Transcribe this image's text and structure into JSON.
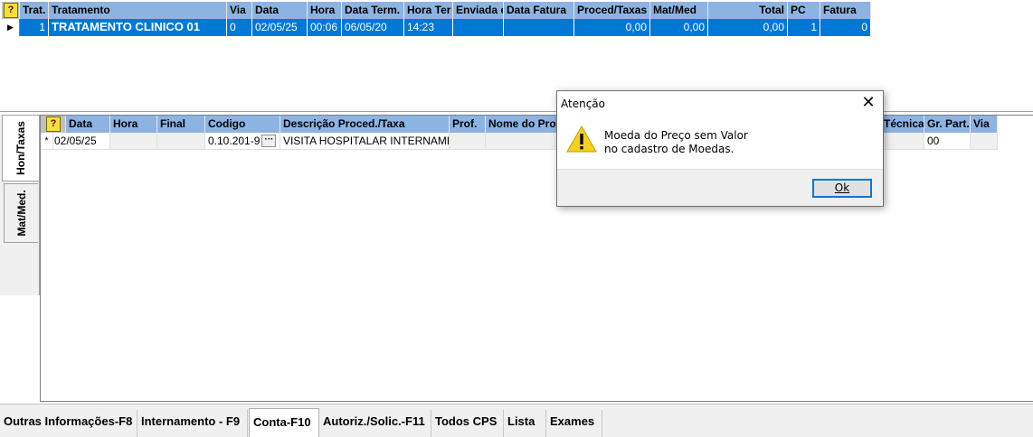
{
  "top_grid": {
    "help_icon": "?",
    "columns": [
      "Trat.",
      "Tratamento",
      "Via",
      "Data",
      "Hora",
      "Data Term.",
      "Hora Ter",
      "Enviada e",
      "Data Fatura",
      "Proced/Taxas",
      "Mat/Med",
      "Total",
      "PC",
      "Fatura"
    ],
    "row": {
      "indicator": "▶",
      "trat": "1",
      "tratamento": "TRATAMENTO CLINICO 01",
      "via": "0",
      "data": "02/05/25",
      "hora": "00:06",
      "data_term": "06/05/20",
      "hora_term": "14:23",
      "enviada": "",
      "data_fatura": "",
      "proced_taxas": "0,00",
      "mat_med": "0,00",
      "total": "0,00",
      "pc": "1",
      "fatura": "0"
    }
  },
  "side_tabs": [
    "Hon/Taxas",
    "Mat/Med."
  ],
  "bottom_grid": {
    "help_icon": "?",
    "columns": [
      "Data",
      "Hora",
      "Final",
      "Codigo",
      "Descrição Proced./Taxa",
      "Prof.",
      "Nome do Prof",
      "Técnica",
      "Gr. Part.",
      "Via"
    ],
    "row": {
      "indicator": "*",
      "data": "02/05/25",
      "hora": "",
      "final": "",
      "codigo": "0.10.201-9",
      "ellipsis": "···",
      "descricao": "VISITA HOSPITALAR INTERNAME",
      "prof": "",
      "nome_prof": "",
      "tecnica": "",
      "gr_part": "00",
      "via": ""
    }
  },
  "bottom_tabs": [
    "Outras Informações-F8",
    "Internamento - F9",
    "Conta-F10",
    "Autoriz./Solic.-F11",
    "Todos CPS",
    "Lista",
    "Exames"
  ],
  "active_bottom_tab": "Conta-F10",
  "dialog": {
    "title": "Atenção",
    "close_icon": "✕",
    "icon": "warning-icon",
    "message_line1": "Moeda do Preço sem Valor",
    "message_line2": "no cadastro de Moedas.",
    "ok_label": "Ok"
  },
  "colors": {
    "header_blue": "#8db3e2",
    "selection_blue": "#0078d7",
    "warning_yellow": "#f7d11b"
  }
}
